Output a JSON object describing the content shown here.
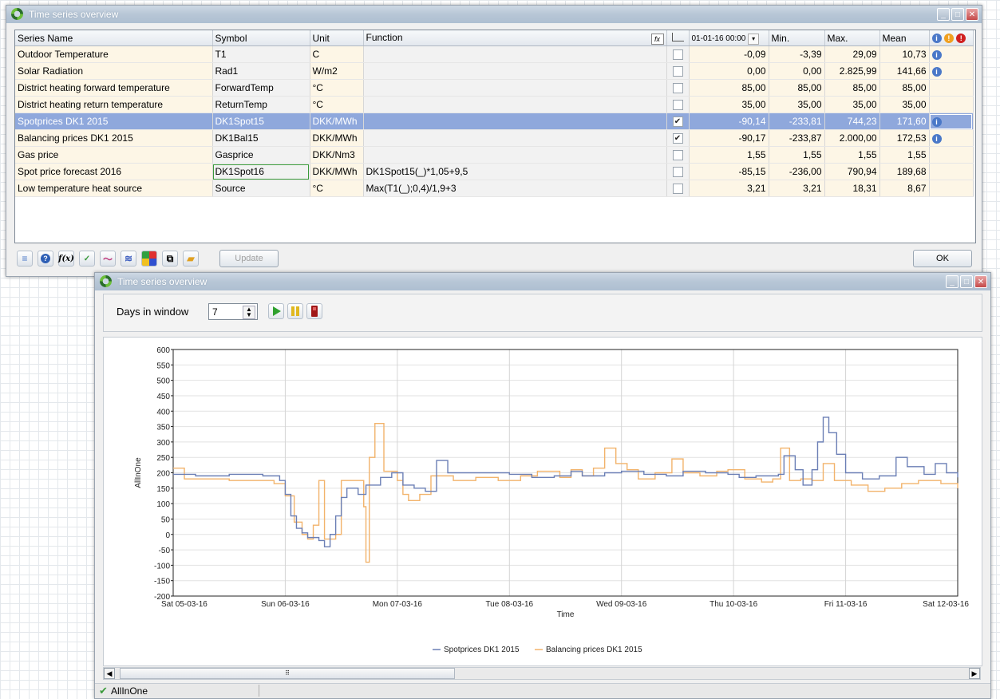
{
  "window1": {
    "title": "Time series overview",
    "columns": [
      "Series Name",
      "Symbol",
      "Unit",
      "Function",
      "",
      "",
      "Min.",
      "Max.",
      "Mean",
      ""
    ],
    "date_select": "01-01-16 00:00",
    "rows": [
      {
        "name": "Outdoor Temperature",
        "symbol": "T1",
        "unit": "C",
        "function": "",
        "checked": false,
        "value": "-0,09",
        "min": "-3,39",
        "max": "29,09",
        "mean": "10,73",
        "info": true
      },
      {
        "name": "Solar Radiation",
        "symbol": "Rad1",
        "unit": "W/m2",
        "function": "",
        "checked": false,
        "value": "0,00",
        "min": "0,00",
        "max": "2.825,99",
        "mean": "141,66",
        "info": true
      },
      {
        "name": "District heating forward temperature",
        "symbol": "ForwardTemp",
        "unit": "°C",
        "function": "",
        "checked": false,
        "value": "85,00",
        "min": "85,00",
        "max": "85,00",
        "mean": "85,00",
        "info": false
      },
      {
        "name": "District heating return temperature",
        "symbol": "ReturnTemp",
        "unit": "°C",
        "function": "",
        "checked": false,
        "value": "35,00",
        "min": "35,00",
        "max": "35,00",
        "mean": "35,00",
        "info": false
      },
      {
        "name": "Spotprices DK1 2015",
        "symbol": "DK1Spot15",
        "unit": "DKK/MWh",
        "function": "",
        "checked": true,
        "value": "-90,14",
        "min": "-233,81",
        "max": "744,23",
        "mean": "171,60",
        "info": true
      },
      {
        "name": "Balancing prices DK1 2015",
        "symbol": "DK1Bal15",
        "unit": "DKK/MWh",
        "function": "",
        "checked": true,
        "value": "-90,17",
        "min": "-233,87",
        "max": "2.000,00",
        "mean": "172,53",
        "info": true
      },
      {
        "name": "Gas price",
        "symbol": "Gasprice",
        "unit": "DKK/Nm3",
        "function": "",
        "checked": false,
        "value": "1,55",
        "min": "1,55",
        "max": "1,55",
        "mean": "1,55",
        "info": false
      },
      {
        "name": "Spot price forecast 2016",
        "symbol": "DK1Spot16",
        "unit": "DKK/MWh",
        "function": "DK1Spot15(_)*1,05+9,5",
        "checked": false,
        "value": "-85,15",
        "min": "-236,00",
        "max": "790,94",
        "mean": "189,68",
        "info": false
      },
      {
        "name": "Low temperature heat source",
        "symbol": "Source",
        "unit": "°C",
        "function": "Max(T1(_);0,4)/1,9+3",
        "checked": false,
        "value": "3,21",
        "min": "3,21",
        "max": "18,31",
        "mean": "8,67",
        "info": false
      }
    ],
    "update_label": "Update",
    "ok_label": "OK"
  },
  "window2": {
    "title": "Time series overview",
    "days_label": "Days in window",
    "days_value": "7",
    "status_text": "AllInOne"
  },
  "chart_data": {
    "type": "line",
    "xlabel": "Time",
    "ylabel": "AllInOne",
    "ylim": [
      -200,
      600
    ],
    "yticks": [
      600,
      550,
      500,
      450,
      400,
      350,
      300,
      250,
      200,
      150,
      100,
      50,
      0,
      -50,
      -100,
      -150,
      -200
    ],
    "xticks": [
      "Sat 05-03-16",
      "Sun 06-03-16",
      "Mon 07-03-16",
      "Tue 08-03-16",
      "Wed 09-03-16",
      "Thu 10-03-16",
      "Fri 11-03-16",
      "Sat 12-03-16"
    ],
    "x_days": [
      0,
      7
    ],
    "grid": true,
    "legend_position": "bottom",
    "colors": {
      "spot": "#6b7fb5",
      "bal": "#f2b36b"
    },
    "series": [
      {
        "name": "Spotprices DK1 2015",
        "points": [
          [
            0,
            195
          ],
          [
            0.2,
            190
          ],
          [
            0.5,
            195
          ],
          [
            0.8,
            190
          ],
          [
            0.95,
            175
          ],
          [
            1.0,
            130
          ],
          [
            1.05,
            60
          ],
          [
            1.1,
            20
          ],
          [
            1.15,
            5
          ],
          [
            1.2,
            -10
          ],
          [
            1.3,
            -20
          ],
          [
            1.35,
            -40
          ],
          [
            1.4,
            0
          ],
          [
            1.45,
            60
          ],
          [
            1.5,
            120
          ],
          [
            1.55,
            150
          ],
          [
            1.65,
            130
          ],
          [
            1.72,
            160
          ],
          [
            1.85,
            185
          ],
          [
            1.95,
            200
          ],
          [
            2.05,
            160
          ],
          [
            2.15,
            150
          ],
          [
            2.25,
            140
          ],
          [
            2.35,
            240
          ],
          [
            2.45,
            200
          ],
          [
            2.7,
            200
          ],
          [
            3.0,
            195
          ],
          [
            3.2,
            185
          ],
          [
            3.4,
            190
          ],
          [
            3.55,
            205
          ],
          [
            3.65,
            190
          ],
          [
            3.85,
            200
          ],
          [
            4.0,
            205
          ],
          [
            4.2,
            195
          ],
          [
            4.4,
            190
          ],
          [
            4.55,
            205
          ],
          [
            4.75,
            200
          ],
          [
            4.95,
            195
          ],
          [
            5.05,
            185
          ],
          [
            5.2,
            190
          ],
          [
            5.4,
            195
          ],
          [
            5.45,
            255
          ],
          [
            5.55,
            210
          ],
          [
            5.62,
            160
          ],
          [
            5.7,
            210
          ],
          [
            5.75,
            300
          ],
          [
            5.8,
            380
          ],
          [
            5.85,
            330
          ],
          [
            5.92,
            260
          ],
          [
            6.0,
            200
          ],
          [
            6.15,
            180
          ],
          [
            6.3,
            190
          ],
          [
            6.45,
            250
          ],
          [
            6.55,
            220
          ],
          [
            6.7,
            195
          ],
          [
            6.8,
            230
          ],
          [
            6.9,
            200
          ],
          [
            7.0,
            185
          ]
        ]
      },
      {
        "name": "Balancing prices DK1 2015",
        "points": [
          [
            0,
            215
          ],
          [
            0.1,
            180
          ],
          [
            0.5,
            175
          ],
          [
            0.9,
            165
          ],
          [
            1.0,
            125
          ],
          [
            1.08,
            40
          ],
          [
            1.15,
            0
          ],
          [
            1.2,
            -15
          ],
          [
            1.25,
            30
          ],
          [
            1.3,
            175
          ],
          [
            1.35,
            -15
          ],
          [
            1.45,
            0
          ],
          [
            1.5,
            175
          ],
          [
            1.62,
            175
          ],
          [
            1.7,
            90
          ],
          [
            1.72,
            -90
          ],
          [
            1.75,
            250
          ],
          [
            1.8,
            360
          ],
          [
            1.88,
            205
          ],
          [
            1.95,
            205
          ],
          [
            2.0,
            175
          ],
          [
            2.05,
            130
          ],
          [
            2.1,
            110
          ],
          [
            2.2,
            130
          ],
          [
            2.3,
            190
          ],
          [
            2.5,
            175
          ],
          [
            2.7,
            185
          ],
          [
            2.9,
            175
          ],
          [
            3.1,
            190
          ],
          [
            3.25,
            205
          ],
          [
            3.45,
            185
          ],
          [
            3.55,
            210
          ],
          [
            3.65,
            190
          ],
          [
            3.75,
            215
          ],
          [
            3.85,
            280
          ],
          [
            3.95,
            230
          ],
          [
            4.05,
            210
          ],
          [
            4.15,
            180
          ],
          [
            4.3,
            200
          ],
          [
            4.45,
            245
          ],
          [
            4.55,
            200
          ],
          [
            4.7,
            190
          ],
          [
            4.85,
            205
          ],
          [
            4.95,
            210
          ],
          [
            5.1,
            180
          ],
          [
            5.25,
            170
          ],
          [
            5.35,
            180
          ],
          [
            5.42,
            280
          ],
          [
            5.5,
            175
          ],
          [
            5.6,
            180
          ],
          [
            5.7,
            175
          ],
          [
            5.8,
            230
          ],
          [
            5.9,
            175
          ],
          [
            6.05,
            160
          ],
          [
            6.2,
            140
          ],
          [
            6.35,
            150
          ],
          [
            6.5,
            165
          ],
          [
            6.65,
            175
          ],
          [
            6.85,
            165
          ],
          [
            7.0,
            150
          ]
        ]
      }
    ]
  }
}
